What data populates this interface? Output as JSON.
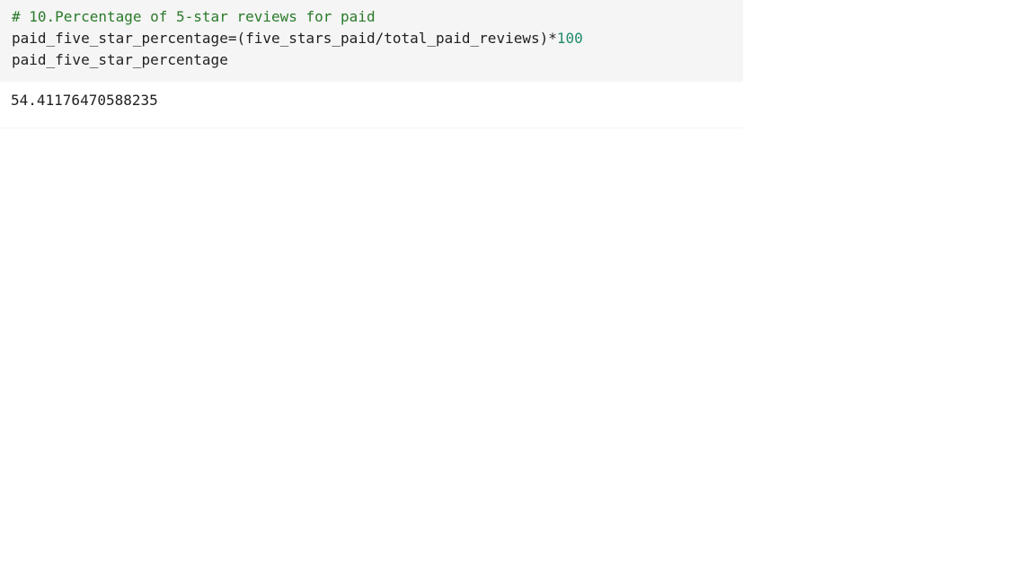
{
  "cell": {
    "code": {
      "comment": "# 10.Percentage of 5-star reviews for paid",
      "line2_expr": "paid_five_star_percentage=(five_stars_paid/total_paid_reviews)*",
      "line2_number": "100",
      "line3": "paid_five_star_percentage"
    },
    "output": "54.41176470588235"
  },
  "colors": {
    "input_bg": "#f5f5f5",
    "comment": "#2a7a2a",
    "number": "#1f8a6a",
    "text": "#212121"
  }
}
